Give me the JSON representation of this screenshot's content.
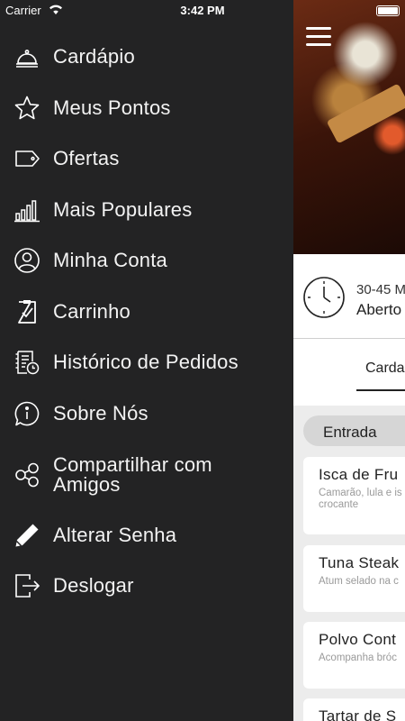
{
  "status_bar": {
    "carrier": "Carrier",
    "time": "3:42 PM"
  },
  "menu": {
    "items": [
      {
        "label": "Cardápio",
        "icon": "cloche-icon"
      },
      {
        "label": "Meus Pontos",
        "icon": "star-icon"
      },
      {
        "label": "Ofertas",
        "icon": "tag-icon"
      },
      {
        "label": "Mais Populares",
        "icon": "bar-chart-icon"
      },
      {
        "label": "Minha Conta",
        "icon": "user-circle-icon"
      },
      {
        "label": "Carrinho",
        "icon": "clipboard-check-icon"
      },
      {
        "label": "Histórico de Pedidos",
        "icon": "order-history-icon"
      },
      {
        "label": "Sobre Nós",
        "icon": "info-bubble-icon"
      },
      {
        "label": "Compartilhar com Amigos",
        "icon": "share-icon"
      },
      {
        "label": "Alterar Senha",
        "icon": "pencil-icon"
      },
      {
        "label": "Deslogar",
        "icon": "logout-icon"
      }
    ]
  },
  "restaurant": {
    "eta": "30-45 M",
    "open_status": "Aberto"
  },
  "tabs": {
    "active": "Carda"
  },
  "category": {
    "selected": "Entrada"
  },
  "dishes": [
    {
      "name": "Isca de Fru",
      "description": "Camarão, lula e is\ncrocante"
    },
    {
      "name": "Tuna Steak",
      "description": "Atum selado na c"
    },
    {
      "name": "Polvo Cont",
      "description": "Acompanha bróc"
    },
    {
      "name": "Tartar de S",
      "description": ""
    }
  ]
}
